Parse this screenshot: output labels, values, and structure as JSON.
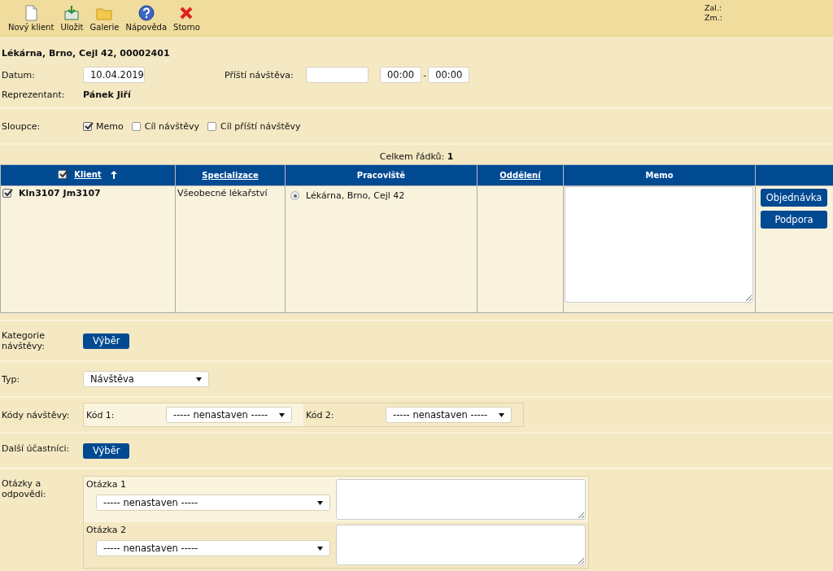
{
  "toolbar": {
    "buttons": [
      {
        "kind": "new",
        "label": "Nový klient"
      },
      {
        "kind": "save",
        "label": "Uložit"
      },
      {
        "kind": "gallery",
        "label": "Galerie"
      },
      {
        "kind": "help",
        "label": "Nápověda"
      },
      {
        "kind": "cancel",
        "label": "Storno"
      }
    ],
    "info": [
      "Zal.:",
      "Zm.:"
    ]
  },
  "header": {
    "title": "Lékárna, Brno, Cejl 42, 00002401",
    "date_label": "Datum:",
    "date_value": "10.04.2019",
    "next_visit_label": "Příští návštěva:",
    "time_from": "00:00",
    "time_separator": "-",
    "time_to": "00:00",
    "rep_label": "Reprezentant:",
    "rep_value": "Pánek Jiří"
  },
  "columns_option": {
    "label": "Sloupce:",
    "options": [
      {
        "label": "Memo",
        "checked": true
      },
      {
        "label": "Cíl návštěvy",
        "checked": false
      },
      {
        "label": "Cíl příští návštěvy",
        "checked": false
      }
    ]
  },
  "table": {
    "total_label": "Celkem řádků:",
    "total": "1",
    "select_all_checked": true,
    "columns": [
      {
        "label": "Klient",
        "kind": "link",
        "sorted": true
      },
      {
        "label": "Specializace",
        "kind": "link",
        "sorted": false
      },
      {
        "label": "Pracoviště",
        "kind": "plain",
        "sorted": false
      },
      {
        "label": "Oddělení",
        "kind": "link",
        "sorted": false
      },
      {
        "label": "Memo",
        "kind": "plain",
        "sorted": false
      }
    ],
    "rows": [
      {
        "checked": true,
        "client": "Kln3107 Jm3107",
        "specialization": "Všeobecné lékařství",
        "workplace": "Lékárna, Brno, Cejl 42",
        "workplace_selected": true,
        "actions": [
          "Objednávka",
          "Podpora"
        ]
      }
    ]
  },
  "form": {
    "category_label": "Kategorie návštěvy:",
    "category_button": "Výběr",
    "type_label": "Typ:",
    "type_value": "Návštěva",
    "codes_label": "Kódy návštěvy:",
    "codes": [
      {
        "label": "Kód 1:",
        "value": "----- nenastaven -----"
      },
      {
        "label": "Kód 2:",
        "value": "----- nenastaven -----"
      }
    ],
    "participants_label": "Další účastníci:",
    "participants_button": "Výběr",
    "questions_label": "Otázky a odpovědi:",
    "questions": [
      {
        "label": "Otázka 1",
        "value": "----- nenastaven -----"
      },
      {
        "label": "Otázka 2",
        "value": "----- nenastaven -----"
      }
    ]
  }
}
